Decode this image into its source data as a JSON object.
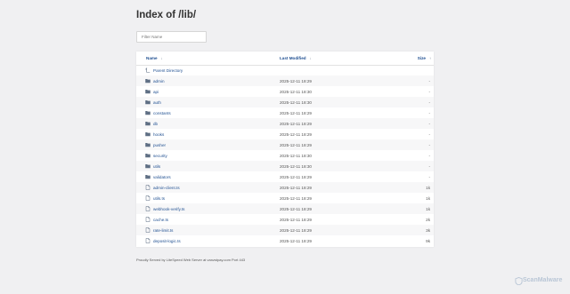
{
  "page": {
    "title": "Index of /lib/",
    "filter_placeholder": "Filter Name",
    "footer": "Proudly Served by LiteSpeed Web Server at vanzstpay.com Port 443",
    "watermark": "ScanMalware"
  },
  "columns": {
    "name": "Name",
    "name_sort": "↓",
    "modified": "Last Modified",
    "modified_sort": "↓",
    "size": "Size",
    "size_sort": "↑"
  },
  "rows": [
    {
      "name": "Parent Directory",
      "date": "",
      "size": "",
      "icon": "parent-dir-icon"
    },
    {
      "name": "admin",
      "date": "2025-12-11 18:29",
      "size": "-",
      "icon": "folder-icon"
    },
    {
      "name": "api",
      "date": "2025-12-11 18:30",
      "size": "-",
      "icon": "folder-icon"
    },
    {
      "name": "auth",
      "date": "2025-12-11 18:30",
      "size": "-",
      "icon": "folder-icon"
    },
    {
      "name": "constants",
      "date": "2025-12-11 18:29",
      "size": "-",
      "icon": "folder-icon"
    },
    {
      "name": "db",
      "date": "2025-12-11 18:29",
      "size": "-",
      "icon": "folder-icon"
    },
    {
      "name": "hooks",
      "date": "2025-12-11 18:29",
      "size": "-",
      "icon": "folder-icon"
    },
    {
      "name": "pusher",
      "date": "2025-12-11 18:29",
      "size": "-",
      "icon": "folder-icon"
    },
    {
      "name": "security",
      "date": "2025-12-11 18:30",
      "size": "-",
      "icon": "folder-icon"
    },
    {
      "name": "utils",
      "date": "2025-12-11 18:30",
      "size": "-",
      "icon": "folder-icon"
    },
    {
      "name": "validators",
      "date": "2025-12-11 18:29",
      "size": "-",
      "icon": "folder-icon"
    },
    {
      "name": "admin-client.ts",
      "date": "2025-12-11 18:29",
      "size": "1k",
      "icon": "file-icon"
    },
    {
      "name": "utils.ts",
      "date": "2025-12-11 18:29",
      "size": "1k",
      "icon": "file-icon"
    },
    {
      "name": "webhook-verify.ts",
      "date": "2025-12-11 18:29",
      "size": "1k",
      "icon": "file-icon"
    },
    {
      "name": "cache.ts",
      "date": "2025-12-11 18:29",
      "size": "2k",
      "icon": "file-icon"
    },
    {
      "name": "rate-limit.ts",
      "date": "2025-12-11 18:29",
      "size": "3k",
      "icon": "file-icon"
    },
    {
      "name": "deposit-logic.ts",
      "date": "2025-12-11 18:29",
      "size": "9k",
      "icon": "file-icon"
    }
  ]
}
